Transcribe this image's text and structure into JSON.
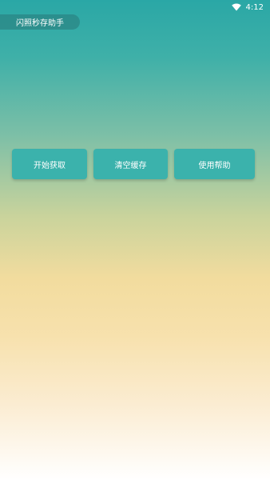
{
  "status_bar": {
    "time": "4:12",
    "icon": "wifi-icon"
  },
  "header": {
    "title": "闪照秒存助手"
  },
  "buttons": [
    {
      "label": "开始获取"
    },
    {
      "label": "清空缓存"
    },
    {
      "label": "使用帮助"
    }
  ],
  "colors": {
    "gradient_top": "#2aa7a6",
    "gradient_mid": "#f2dc9e",
    "gradient_bottom": "#ffffff",
    "button_bg": "#3bb2ac"
  }
}
